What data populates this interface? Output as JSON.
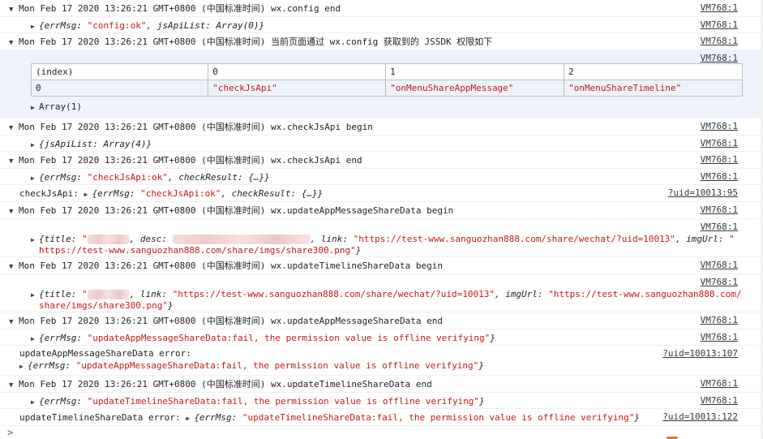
{
  "rows": [
    {
      "type": "group",
      "text": "Mon Feb 17 2020 13:26:21 GMT+0800 (中国标准时间) wx.config end",
      "source": "VM768:1"
    },
    {
      "type": "obj",
      "source": "VM768:1",
      "parts": [
        {
          "c": "obj",
          "t": "{errMsg: "
        },
        {
          "c": "str",
          "t": "\"config:ok\""
        },
        {
          "c": "obj",
          "t": ", jsApiList: Array(0)}"
        }
      ]
    },
    {
      "type": "group",
      "text": "Mon Feb 17 2020 13:26:21 GMT+0800 (中国标准时间) 当前页面通过 wx.config 获取到的 JSSDK 权限如下",
      "source": "VM768:1"
    },
    {
      "type": "table",
      "source": "VM768:1",
      "headers": [
        "(index)",
        "0",
        "1",
        "2"
      ],
      "cells": [
        "0",
        "\"checkJsApi\"",
        "\"onMenuShareAppMessage\"",
        "\"onMenuShareTimeline\""
      ],
      "footer": "Array(1)"
    },
    {
      "type": "group",
      "text": "Mon Feb 17 2020 13:26:21 GMT+0800 (中国标准时间) wx.checkJsApi begin",
      "source": "VM768:1"
    },
    {
      "type": "obj",
      "source": "VM768:1",
      "parts": [
        {
          "c": "obj",
          "t": "{jsApiList: Array(4)}"
        }
      ]
    },
    {
      "type": "group",
      "text": "Mon Feb 17 2020 13:26:21 GMT+0800 (中国标准时间) wx.checkJsApi end",
      "source": "VM768:1"
    },
    {
      "type": "obj",
      "source": "VM768:1",
      "parts": [
        {
          "c": "obj",
          "t": "{errMsg: "
        },
        {
          "c": "str",
          "t": "\"checkJsApi:ok\""
        },
        {
          "c": "obj",
          "t": ", checkResult: {…}}"
        }
      ]
    },
    {
      "type": "log",
      "source": "?uid=10013:95",
      "label": "checkJsApi: ",
      "parts": [
        {
          "c": "obj",
          "t": "{errMsg: "
        },
        {
          "c": "str",
          "t": "\"checkJsApi:ok\""
        },
        {
          "c": "obj",
          "t": ", checkResult: {…}}"
        }
      ]
    },
    {
      "type": "group",
      "text": "Mon Feb 17 2020 13:26:21 GMT+0800 (中国标准时间) wx.updateAppMessageShareData begin",
      "source": "VM768:1"
    },
    {
      "type": "obj2",
      "source": "VM768:1",
      "line1": [
        {
          "c": "obj",
          "t": "{title: "
        },
        {
          "c": "str",
          "t": "\""
        },
        {
          "c": "blur",
          "w": 52
        },
        {
          "c": "obj",
          "t": ", desc: "
        },
        {
          "c": "blur",
          "w": 170
        },
        {
          "c": "obj",
          "t": ", link: "
        },
        {
          "c": "str",
          "t": "\"https://test-www.sanguozhan888.com/share/wechat/?uid=10013\""
        },
        {
          "c": "obj",
          "t": ", imgUrl: "
        },
        {
          "c": "str",
          "t": "\""
        }
      ],
      "line2": [
        {
          "c": "str",
          "t": "https://test-www.sanguozhan888.com/share/imgs/share300.png\""
        },
        {
          "c": "obj",
          "t": "}"
        }
      ]
    },
    {
      "type": "group",
      "text": "Mon Feb 17 2020 13:26:21 GMT+0800 (中国标准时间) wx.updateTimelineShareData begin",
      "source": "VM768:1"
    },
    {
      "type": "obj2",
      "source": "VM768:1",
      "line1": [
        {
          "c": "obj",
          "t": "{title: "
        },
        {
          "c": "str",
          "t": "\""
        },
        {
          "c": "blur",
          "w": 52
        },
        {
          "c": "obj",
          "t": ", link: "
        },
        {
          "c": "str",
          "t": "\"https://test-www.sanguozhan888.com/share/wechat/?uid=10013\""
        },
        {
          "c": "obj",
          "t": ", imgUrl: "
        },
        {
          "c": "str",
          "t": "\"https://test-www.sanguozhan888.com/"
        }
      ],
      "line2": [
        {
          "c": "str",
          "t": "share/imgs/share300.png\""
        },
        {
          "c": "obj",
          "t": "}"
        }
      ]
    },
    {
      "type": "group",
      "text": "Mon Feb 17 2020 13:26:21 GMT+0800 (中国标准时间) wx.updateAppMessageShareData end",
      "source": "VM768:1"
    },
    {
      "type": "obj",
      "source": "VM768:1",
      "parts": [
        {
          "c": "obj",
          "t": "{errMsg: "
        },
        {
          "c": "str",
          "t": "\"updateAppMessageShareData:fail, the permission value is offline verifying\""
        },
        {
          "c": "obj",
          "t": "}"
        }
      ]
    },
    {
      "type": "log2",
      "source": "?uid=10013:107",
      "label": "updateAppMessageShareData error:",
      "parts": [
        {
          "c": "obj",
          "t": "{errMsg: "
        },
        {
          "c": "str",
          "t": "\"updateAppMessageShareData:fail, the permission value is offline verifying\""
        },
        {
          "c": "obj",
          "t": "}"
        }
      ]
    },
    {
      "type": "group",
      "text": "Mon Feb 17 2020 13:26:21 GMT+0800 (中国标准时间) wx.updateTimelineShareData end",
      "source": "VM768:1"
    },
    {
      "type": "obj",
      "source": "VM768:1",
      "parts": [
        {
          "c": "obj",
          "t": "{errMsg: "
        },
        {
          "c": "str",
          "t": "\"updateTimelineShareData:fail, the permission value is offline verifying\""
        },
        {
          "c": "obj",
          "t": "}"
        }
      ]
    },
    {
      "type": "log",
      "source": "?uid=10013:122",
      "label": "updateTimelineShareData error: ",
      "parts": [
        {
          "c": "obj",
          "t": "{errMsg: "
        },
        {
          "c": "str",
          "t": "\"updateTimelineShareData:fail, the permission value is offline verifying\""
        },
        {
          "c": "obj",
          "t": "}"
        }
      ]
    }
  ],
  "prompt": ">",
  "colors": {
    "string": "#c41a16",
    "link": "#303942",
    "prompt": "#1a73e8",
    "table_border": "#bdbdbd",
    "table_bg": "#eef3fb"
  }
}
